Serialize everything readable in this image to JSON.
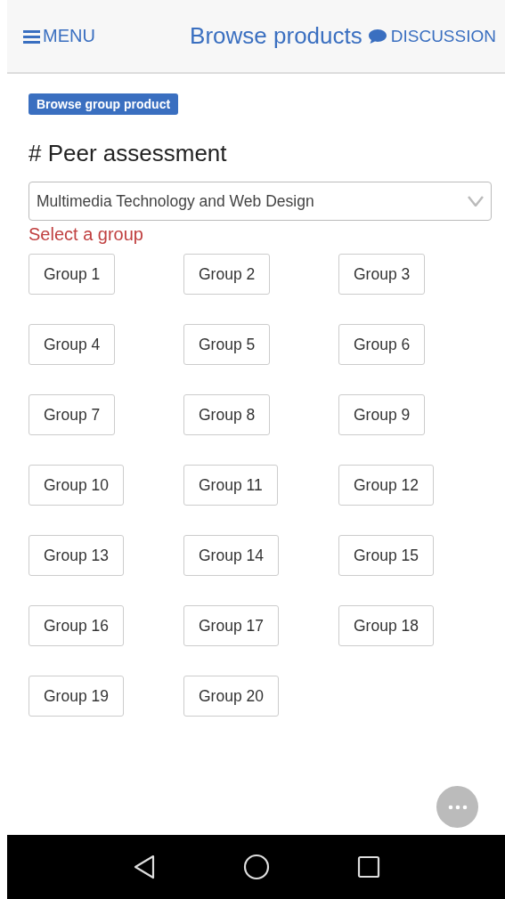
{
  "header": {
    "menu_label": "MENU",
    "title": "Browse products",
    "discussion_label": "DISCUSSION"
  },
  "tag": "Browse group product",
  "heading": "# Peer assessment",
  "course_select": {
    "value": "Multimedia Technology and Web Design"
  },
  "error": "Select a group",
  "groups": [
    {
      "label": "Group 1"
    },
    {
      "label": "Group 2"
    },
    {
      "label": "Group 3"
    },
    {
      "label": "Group 4"
    },
    {
      "label": "Group 5"
    },
    {
      "label": "Group 6"
    },
    {
      "label": "Group 7"
    },
    {
      "label": "Group 8"
    },
    {
      "label": "Group 9"
    },
    {
      "label": "Group 10"
    },
    {
      "label": "Group 11"
    },
    {
      "label": "Group 12"
    },
    {
      "label": "Group 13"
    },
    {
      "label": "Group 14"
    },
    {
      "label": "Group 15"
    },
    {
      "label": "Group 16"
    },
    {
      "label": "Group 17"
    },
    {
      "label": "Group 18"
    },
    {
      "label": "Group 19"
    },
    {
      "label": "Group 20"
    }
  ]
}
